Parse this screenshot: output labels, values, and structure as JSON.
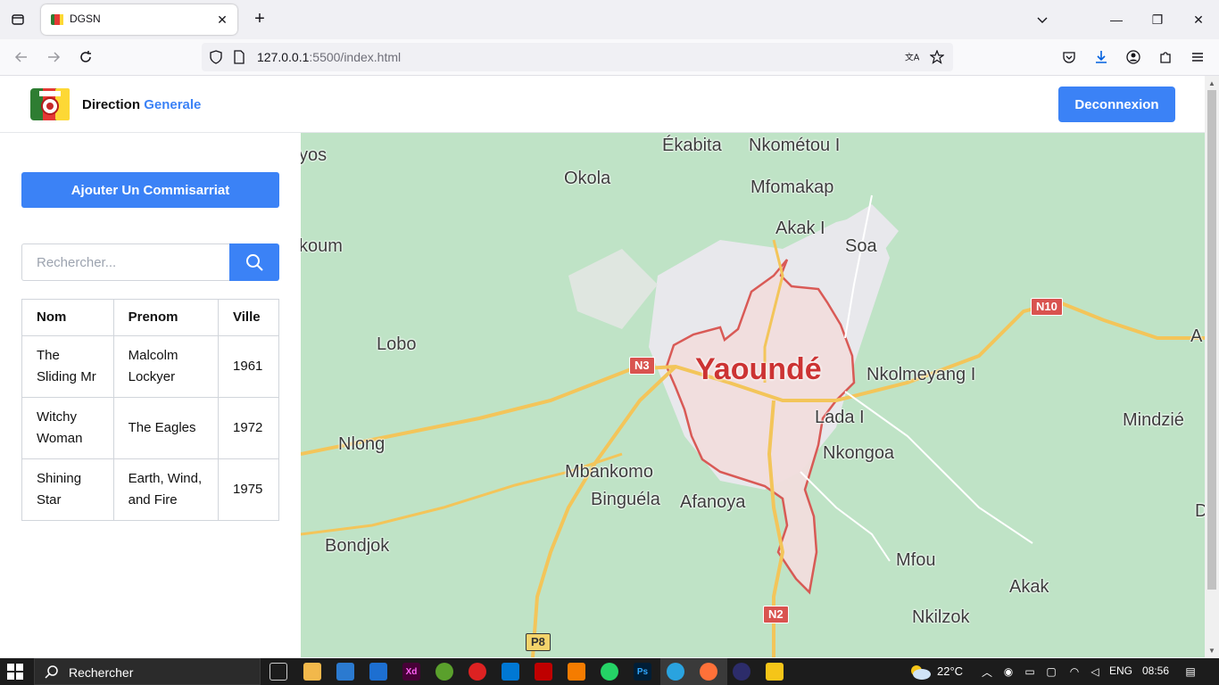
{
  "browser": {
    "tab_title": "DGSN",
    "url_host": "127.0.0.1",
    "url_rest": ":5500/index.html"
  },
  "header": {
    "brand_main": "Direction",
    "brand_accent": "Generale",
    "logout_label": "Deconnexion"
  },
  "sidebar": {
    "add_label": "Ajouter Un Commisarriat",
    "search_placeholder": "Rechercher...",
    "table": {
      "headers": [
        "Nom",
        "Prenom",
        "Ville"
      ],
      "rows": [
        [
          "The Sliding Mr",
          "Malcolm Lockyer",
          "1961"
        ],
        [
          "Witchy Woman",
          "The Eagles",
          "1972"
        ],
        [
          "Shining Star",
          "Earth, Wind, and Fire",
          "1975"
        ]
      ]
    }
  },
  "map": {
    "city": "Yaoundé",
    "places": [
      "yos",
      "Ékabita",
      "Nkométou I",
      "Okola",
      "Mfomakap",
      "Akak I",
      "Soa",
      "koum",
      "Lobo",
      "Nkolmeyang I",
      "Lada I",
      "Mindzié",
      "Nlong",
      "Nkongoa",
      "Mbankomo",
      "Binguéla",
      "Afanoya",
      "Bondjok",
      "Mfou",
      "Akak",
      "Nkilzok",
      "A",
      "D"
    ],
    "roads": [
      "N3",
      "N10",
      "N2",
      "P8"
    ]
  },
  "taskbar": {
    "search_label": "Rechercher",
    "weather": "22°C",
    "language": "ENG",
    "time": "08:56"
  },
  "colors": {
    "accent": "#3b82f6",
    "map_bg": "#bfe3c6",
    "city_outline": "#d9534f"
  }
}
